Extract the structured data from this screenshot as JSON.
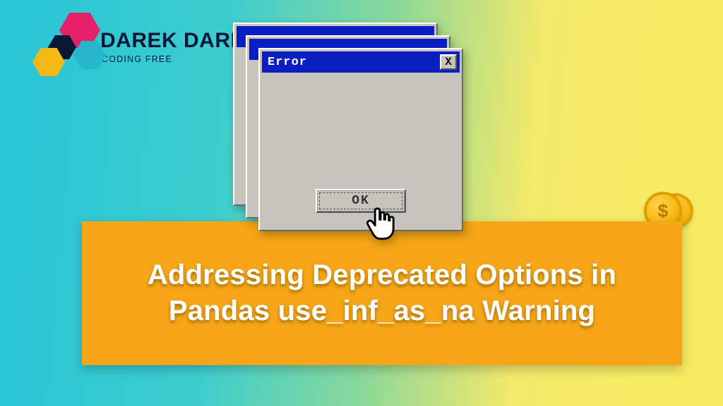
{
  "brand": {
    "name": "DAREK DARI",
    "tagline": "CODING FREE"
  },
  "colors": {
    "accent_orange": "#f5a515",
    "titlebar_blue": "#0a1fc2",
    "bg_teal": "#29c4d6",
    "bg_yellow": "#f6eb5e"
  },
  "dialog": {
    "title": "Error",
    "ok_label": "OK",
    "close_glyph": "X"
  },
  "coin": {
    "glyph": "$"
  },
  "banner": {
    "headline": "Addressing Deprecated Options in Pandas use_inf_as_na Warning"
  }
}
